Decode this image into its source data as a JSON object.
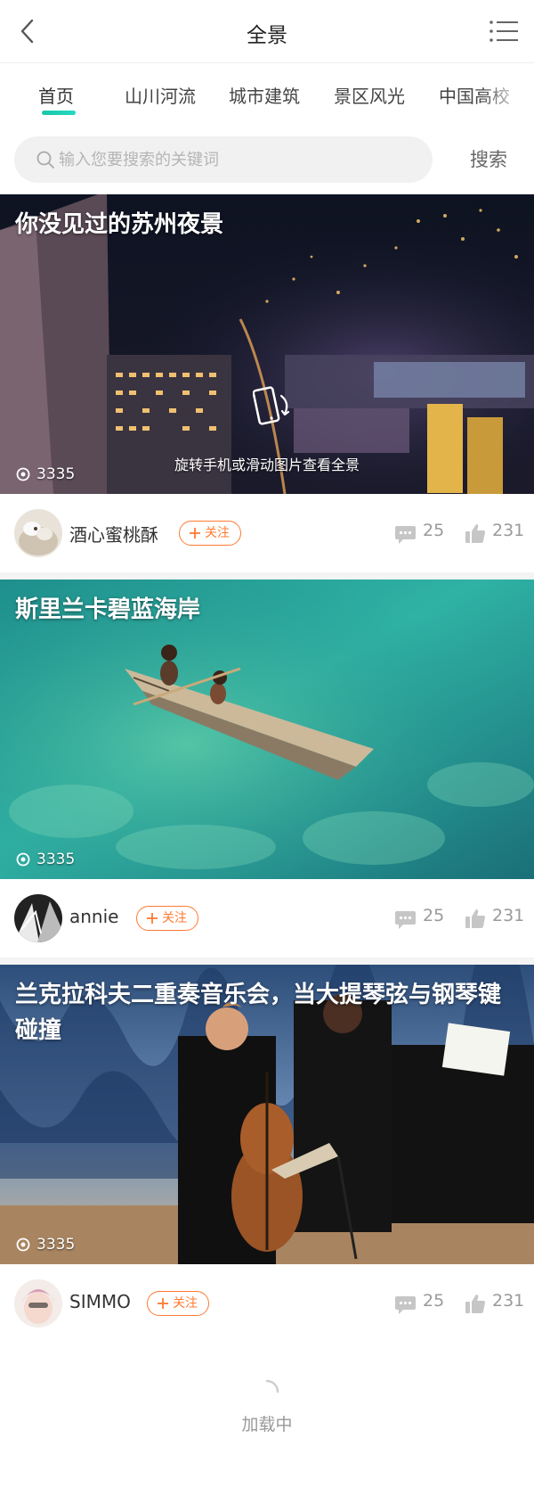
{
  "navbar": {
    "title": "全景"
  },
  "tabs": [
    {
      "label": "首页",
      "active": true
    },
    {
      "label": "山川河流",
      "active": false
    },
    {
      "label": "城市建筑",
      "active": false
    },
    {
      "label": "景区风光",
      "active": false
    },
    {
      "label": "中国高校",
      "active": false
    }
  ],
  "search": {
    "placeholder": "输入您要搜索的关键词",
    "value": "",
    "button_label": "搜索"
  },
  "cards": [
    {
      "title": "你没见过的苏州夜景",
      "views": "3335",
      "hint": "旋转手机或滑动图片查看全景",
      "author": "酒心蜜桃酥",
      "follow_label": "关注",
      "comments": "25",
      "likes": "231"
    },
    {
      "title": "斯里兰卡碧蓝海岸",
      "views": "3335",
      "author": "annie",
      "follow_label": "关注",
      "comments": "25",
      "likes": "231"
    },
    {
      "title": "兰克拉科夫二重奏音乐会，当大提琴弦与钢琴键碰撞",
      "views": "3335",
      "author": "SIMMO",
      "follow_label": "关注",
      "comments": "25",
      "likes": "231"
    }
  ],
  "loader": {
    "text": "加载中"
  },
  "colors": {
    "accent": "#1fd0b5",
    "follow": "#ff7a33",
    "muted": "#9a9a9a"
  }
}
